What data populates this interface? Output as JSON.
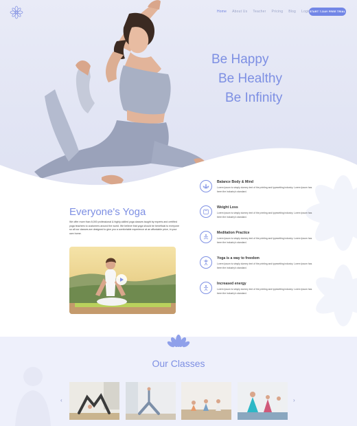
{
  "nav": {
    "items": [
      {
        "label": "Home",
        "active": true
      },
      {
        "label": "About Us",
        "active": false
      },
      {
        "label": "Teacher",
        "active": false
      },
      {
        "label": "Pricing",
        "active": false
      },
      {
        "label": "Blog",
        "active": false
      },
      {
        "label": "Login",
        "active": false
      }
    ],
    "cta_label": "START 7-DAY FREE TRIAL"
  },
  "hero": {
    "lines": [
      "Be Happy",
      "Be Healthy",
      "Be Infinity"
    ]
  },
  "about": {
    "title": "Everyone's Yoga",
    "text": "We offer more than 8,000 professional & highly-skilled yoga classes taught by experts and certified yoga teachers to customers around the world. We believe that yoga should be beneficial to everyone so all our classes are designed to give you a comfortable experience at an affordable price, in your own home."
  },
  "features": [
    {
      "title": "Balance Body & Mind",
      "text": "Lorem Ipsum is simply dummy text of the printing and typesetting industry. Lorem Ipsum has been the industry's standard.",
      "icon": "lotus-icon"
    },
    {
      "title": "Weight Loss",
      "text": "Lorem Ipsum is simply dummy text of the printing and typesetting industry. Lorem Ipsum has been the industry's standard.",
      "icon": "scale-icon"
    },
    {
      "title": "Meditation Practice",
      "text": "Lorem Ipsum is simply dummy text of the printing and typesetting industry. Lorem Ipsum has been the industry's standard.",
      "icon": "meditation-icon"
    },
    {
      "title": "Yoga is a way to freedom",
      "text": "Lorem Ipsum is simply dummy text of the printing and typesetting industry. Lorem Ipsum has been the industry's standard.",
      "icon": "yoga-pose-icon"
    },
    {
      "title": "Increased energy",
      "text": "Lorem Ipsum is simply dummy text of the printing and typesetting industry. Lorem Ipsum has been the industry's standard.",
      "icon": "energy-icon"
    }
  ],
  "classes": {
    "title": "Our Classes",
    "prev": "‹",
    "next": "›"
  },
  "colors": {
    "accent": "#7d8fe3",
    "button": "#7286e6",
    "hero_bg": "#e6e8f6"
  }
}
